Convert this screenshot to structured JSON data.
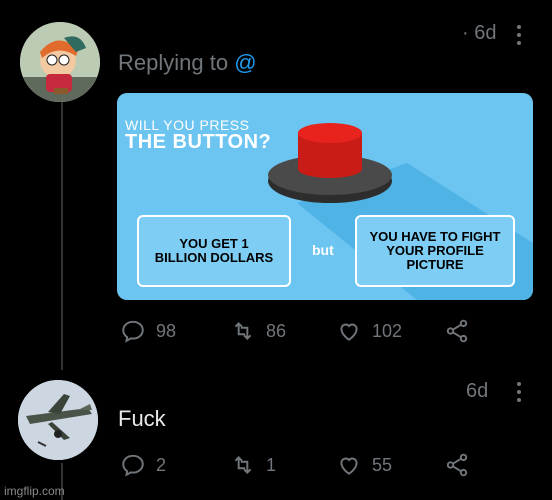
{
  "tweet1": {
    "time": "· 6d",
    "replying_prefix": "Replying to",
    "replying_handle": "@",
    "card": {
      "question_line1": "WILL YOU PRESS",
      "question_line2": "THE BUTTON?",
      "option_left": "YOU GET 1\nBILLION DOLLARS",
      "but_word": "but",
      "option_right": "YOU HAVE TO FIGHT\nYOUR PROFILE PICTURE"
    },
    "replies": "98",
    "retweets": "86",
    "likes": "102"
  },
  "tweet2": {
    "time": "6d",
    "text": "Fuck",
    "replies": "2",
    "retweets": "1",
    "likes": "55"
  },
  "watermark": "imgflip.com",
  "colors": {
    "accent": "#1d9bf0",
    "muted": "#71767b",
    "card_bg": "#6cc4f0",
    "button_red": "#e8231d"
  },
  "icons": [
    "reply-icon",
    "retweet-icon",
    "like-icon",
    "share-icon",
    "more-options-icon"
  ]
}
